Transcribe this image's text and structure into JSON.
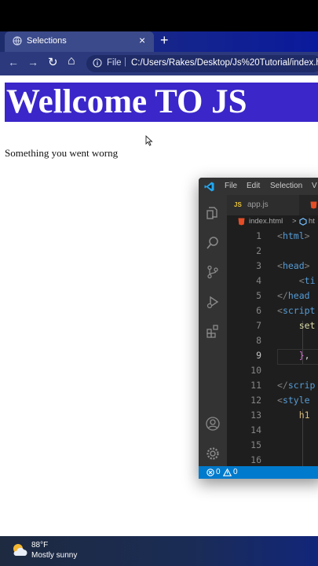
{
  "browser": {
    "tab_title": "Selections",
    "close_glyph": "×",
    "new_tab_glyph": "+",
    "back_glyph": "←",
    "forward_glyph": "→",
    "reload_glyph": "↻",
    "home_glyph": "⌂",
    "address_prefix": "File",
    "address_url": "C:/Users/Rakes/Desktop/Js%20Tutorial/index.html"
  },
  "page": {
    "heading": "Wellcome TO JS",
    "paragraph": "Something you went worng",
    "heading_bg": "#3a26c9"
  },
  "vscode": {
    "menu": [
      "File",
      "Edit",
      "Selection",
      "V"
    ],
    "tabs": [
      {
        "label": "app.js",
        "badge": "JS"
      }
    ],
    "breadcrumb_file": "index.html",
    "breadcrumb_sep": ">",
    "breadcrumb_next": "ht",
    "line_numbers": [
      "1",
      "2",
      "3",
      "4",
      "5",
      "6",
      "7",
      "8",
      "9",
      "10",
      "11",
      "12",
      "13",
      "14",
      "15",
      "16"
    ],
    "active_line": "9",
    "status_errors": "0",
    "status_warnings": "0"
  },
  "taskbar": {
    "temperature": "88°F",
    "condition": "Mostly sunny"
  }
}
